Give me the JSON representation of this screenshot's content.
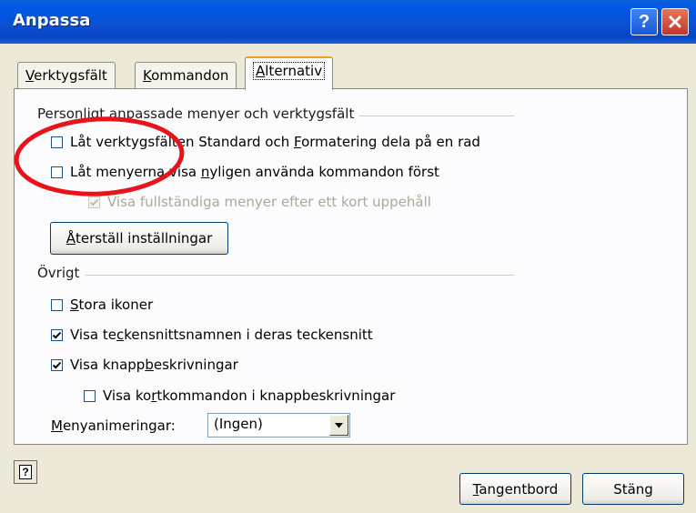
{
  "window": {
    "title": "Anpassa"
  },
  "tabs": [
    {
      "label": "Verktygsfält",
      "active": false
    },
    {
      "label": "Kommandon",
      "active": false
    },
    {
      "label": "Alternativ",
      "active": true
    }
  ],
  "group_personal": {
    "label": "Personligt anpassade menyer och verktygsfält",
    "options": [
      {
        "label": "Låt verktygsfälten Standard och Formatering dela på en rad",
        "checked": false,
        "enabled": true
      },
      {
        "label": "Låt menyerna visa nyligen använda kommandon först",
        "checked": false,
        "enabled": true
      },
      {
        "label": "Visa fullständiga menyer efter ett kort uppehåll",
        "checked": true,
        "enabled": false
      }
    ],
    "reset_button": "Återställ inställningar"
  },
  "group_other": {
    "label": "Övrigt",
    "options": [
      {
        "label": "Stora ikoner",
        "checked": false
      },
      {
        "label": "Visa teckensnittsnamnen i deras teckensnitt",
        "checked": true
      },
      {
        "label": "Visa knappbeskrivningar",
        "checked": true
      },
      {
        "label": "Visa kortkommandon i knappbeskrivningar",
        "checked": false
      }
    ],
    "animation_label": "Menyanimeringar:",
    "animation_value": "(Ingen)"
  },
  "footer": {
    "keyboard_button": "Tangentbord",
    "close_button": "Stäng"
  },
  "colors": {
    "titlebar": "#0a4fd0",
    "callout": "#e8131b",
    "dialog_bg": "#ece9d8"
  },
  "icons": [
    "help-icon",
    "close-icon",
    "check-icon",
    "dropdown-arrow-icon",
    "help-question-icon"
  ]
}
